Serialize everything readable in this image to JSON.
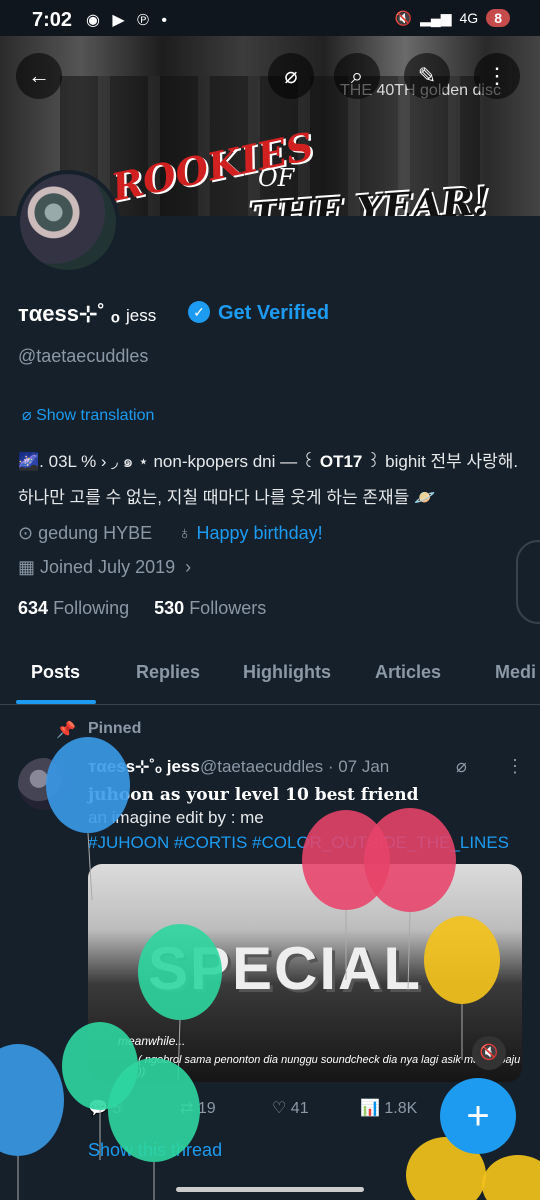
{
  "status": {
    "time": "7:02",
    "icons": "◉ ▶ ℗ •",
    "network": "4G",
    "battery": "8"
  },
  "header": {
    "back_icon": "arrow-left-icon",
    "translate_icon": "translate-icon",
    "search_icon": "search-icon",
    "edit_icon": "pencil-icon",
    "more_icon": "more-vertical-icon"
  },
  "banner": {
    "line1": "ROOKIES",
    "line2": "OF",
    "line3": "THE YEAR!",
    "sign": "THE 40TH golden disc"
  },
  "profile": {
    "display_name": "тαеѕѕ⊹˚ ₒ",
    "name_suffix": "jess",
    "get_verified": "Get Verified",
    "handle": "@taetaecuddles",
    "show_translation": "Show translation",
    "bio_part1": "🌌. 03L % › ◞ ๑ ⋆ non-kpopers dni — ꒰",
    "bio_bold": "OT17",
    "bio_part2": "꒱ bighit 전부 사랑해. 하나만 고를 수 없는, 지칠 때마다 나를 웃게 하는 존재들 🪐",
    "location": "gedung HYBE",
    "birthday": "Happy birthday!",
    "joined": "Joined July 2019",
    "following_count": "634",
    "following_label": "Following",
    "followers_count": "530",
    "followers_label": "Followers"
  },
  "tabs": [
    "Posts",
    "Replies",
    "Highlights",
    "Articles",
    "Medi"
  ],
  "post": {
    "pinned_label": "Pinned",
    "name": "тαеѕѕ⊹˚ₒ jess",
    "meta": "@taetaecuddles · 07 Jan",
    "line1": "juhoon as your level 10 best friend",
    "line2": "an imagine edit by : me",
    "line3": "#JUHOON #CORTIS #COLOR_OUTSIDE_THE_LINES",
    "media_title": "SPECIAL",
    "media_cap1": "meanwhile...",
    "media_cap2": "( ngobrol sama penonton dia nunggu soundcheck dia nya lagi asik mainin baju ))",
    "replies": "5",
    "reposts": "19",
    "likes": "41",
    "views": "1.8K",
    "show_thread": "Show this thread"
  },
  "colors": {
    "background": "#15202b",
    "accent": "#1d9bf0",
    "muted": "#8b98a5"
  }
}
